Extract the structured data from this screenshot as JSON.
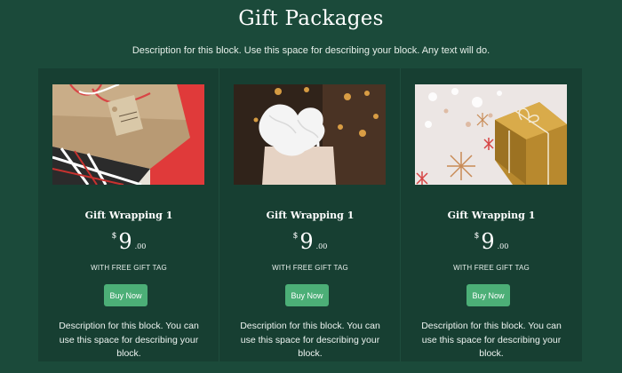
{
  "header": {
    "title": "Gift Packages",
    "subtitle": "Description for this block. Use this space for describing your block. Any text will do."
  },
  "cards": [
    {
      "image": "gift-wrapped-box-photo",
      "title": "Gift Wrapping 1",
      "currency": "$",
      "amount": "9",
      "cents": ".00",
      "tag": "WITH FREE GIFT TAG",
      "button_label": "Buy Now",
      "description": "Description for this block. You can use this space for describing your block."
    },
    {
      "image": "gift-bag-photo",
      "title": "Gift Wrapping 1",
      "currency": "$",
      "amount": "9",
      "cents": ".00",
      "tag": "WITH FREE GIFT TAG",
      "button_label": "Buy Now",
      "description": "Description for this block. You can use this space for describing your block."
    },
    {
      "image": "gold-gift-box-photo",
      "title": "Gift Wrapping 1",
      "currency": "$",
      "amount": "9",
      "cents": ".00",
      "tag": "WITH FREE GIFT TAG",
      "button_label": "Buy Now",
      "description": "Description for this block. You can use this space for describing your block."
    }
  ],
  "colors": {
    "background": "#1b4a3a",
    "card": "#173f32",
    "button": "#4caf77"
  }
}
